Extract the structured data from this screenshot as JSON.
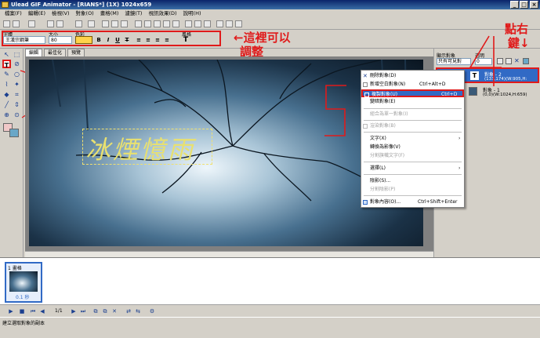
{
  "window": {
    "title": "Ulead GIF Animator - [RIANS*] (1X) 1024x659",
    "minimize": "_",
    "maximize": "□",
    "close": "×"
  },
  "menubar": [
    "檔案(F)",
    "編輯(E)",
    "檢視(V)",
    "對象(O)",
    "畫格(M)",
    "濾鏡(T)",
    "視訊效果(D)",
    "說明(H)"
  ],
  "fontbar": {
    "font_label": "字體",
    "font_value": "王漢宗鋼筆",
    "size_label": "大小",
    "size_value": "80",
    "color_label": "色彩",
    "style_label": "風格",
    "bold": "B",
    "italic": "I",
    "underline": "U",
    "strike": "T",
    "style_icon": "T"
  },
  "annotations": {
    "adjust_line1": "←這裡可以",
    "adjust_line2": "調整",
    "right_click_line1": "點右",
    "right_click_line2": "鍵↓"
  },
  "tabs": [
    "編輯",
    "最佳化",
    "預覽"
  ],
  "canvas": {
    "text": "冰煙憶雨"
  },
  "right_panel": {
    "show_label": "顯示對象",
    "show_value": "只有可見對",
    "opacity_label": "透明",
    "opacity_value": "0",
    "objects": [
      {
        "name": "對象 - 2",
        "detail": "(133,174)(W:905,H:"
      },
      {
        "name": "對象 - 1",
        "detail": "(0,0)(W:1024,H:659)"
      }
    ]
  },
  "context_menu": {
    "items": [
      {
        "label": "刪除對象(D)",
        "shortcut": "",
        "state": "normal"
      },
      {
        "label": "新增空白對象(N)",
        "shortcut": "Ctrl+Alt+D",
        "state": "normal"
      },
      {
        "label": "複製對象(U)",
        "shortcut": "Ctrl+D",
        "state": "highlight"
      },
      {
        "label": "變暗對象(E)",
        "shortcut": "",
        "state": "normal"
      },
      {
        "label": "組合為單一對象(I)",
        "shortcut": "",
        "state": "disabled"
      },
      {
        "label": "渲染對象(B)",
        "shortcut": "",
        "state": "disabled"
      },
      {
        "label": "文字(X)",
        "shortcut": "",
        "state": "submenu"
      },
      {
        "label": "轉換為影像(V)",
        "shortcut": "",
        "state": "normal"
      },
      {
        "label": "分割旗幟文字(F)",
        "shortcut": "",
        "state": "disabled"
      },
      {
        "label": "選擇(L)",
        "shortcut": "",
        "state": "submenu"
      },
      {
        "label": "陰影(S)...",
        "shortcut": "",
        "state": "normal"
      },
      {
        "label": "分割陰影(P)",
        "shortcut": "",
        "state": "disabled"
      },
      {
        "label": "對象內容(O)...",
        "shortcut": "Ctrl+Shift+Enter",
        "state": "normal"
      }
    ]
  },
  "frames": {
    "label": "1 畫格",
    "delay": "0.1 秒"
  },
  "playbar": {
    "counter": "1/1"
  },
  "status": {
    "text": "建立選取對象的副本"
  },
  "colors": {
    "accent": "#316ac5",
    "annotation_red": "#e01a1a",
    "canvas_text": "#e8e070"
  }
}
